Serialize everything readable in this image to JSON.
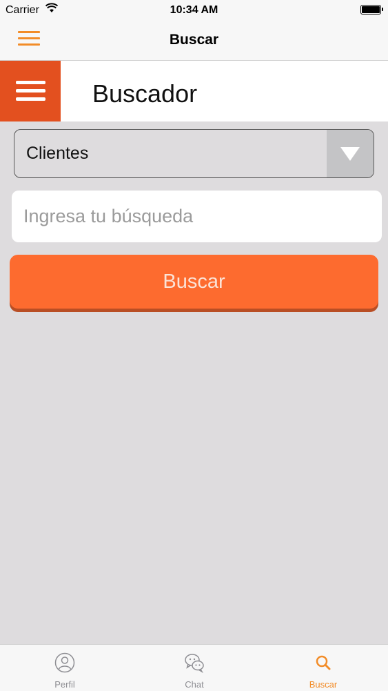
{
  "status_bar": {
    "carrier": "Carrier",
    "time": "10:34 AM",
    "icons": [
      "wifi-icon",
      "battery-icon"
    ]
  },
  "nav_bar": {
    "title": "Buscar",
    "menu_icon": "hamburger-menu-icon"
  },
  "header": {
    "title": "Buscador",
    "menu_icon": "hamburger-menu-icon"
  },
  "search_form": {
    "category_selected": "Clientes",
    "query_value": "",
    "query_placeholder": "Ingresa tu búsqueda",
    "submit_label": "Buscar"
  },
  "tab_bar": {
    "tabs": [
      {
        "label": "Perfil",
        "icon": "person-icon",
        "active": false
      },
      {
        "label": "Chat",
        "icon": "chat-bubbles-icon",
        "active": false
      },
      {
        "label": "Buscar",
        "icon": "search-icon",
        "active": true
      }
    ]
  },
  "colors": {
    "accent_orange": "#f28c28",
    "header_menu_bg": "#e3501f",
    "button_bg": "#fd6b2f",
    "page_bg": "#dedcde",
    "inactive_tab": "#8e8e93"
  }
}
